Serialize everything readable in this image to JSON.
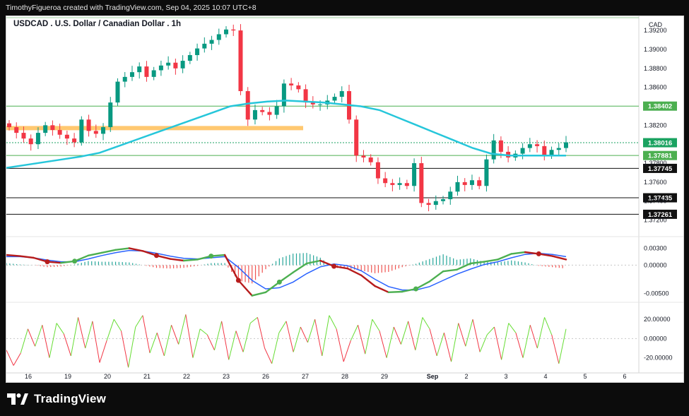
{
  "header": {
    "credit": "TimothyFigueroa created with TradingView.com, Sep 04, 2025 10:07 UTC+8"
  },
  "brand": {
    "name": "TradingView"
  },
  "chart_data": [
    {
      "type": "candlestick",
      "title": "USDCAD . U.S. Dollar / Canadian Dollar . 1h",
      "currency": "CAD",
      "ylim": [
        1.371,
        1.3932
      ],
      "y_ticks": [
        "1.39200",
        "1.39000",
        "1.38800",
        "1.38600",
        "1.38200",
        "1.37800",
        "1.37600",
        "1.37400",
        "1.37200"
      ],
      "x_labels": [
        "16",
        "19",
        "20",
        "21",
        "22",
        "23",
        "26",
        "27",
        "28",
        "29",
        "Sep",
        "2",
        "3",
        "4",
        "5",
        "6"
      ],
      "price_lines": [
        {
          "label": "1.38402",
          "value": 1.38402,
          "color": "#4caf50"
        },
        {
          "label": "1.38016",
          "value": 1.38016,
          "color": "#1aa260"
        },
        {
          "label": "1.37881",
          "value": 1.37881,
          "color": "#4caf50"
        },
        {
          "label": "1.37745",
          "value": 1.37745,
          "color": "#111111"
        },
        {
          "label": "1.37435",
          "value": 1.37435,
          "color": "#111111"
        },
        {
          "label": "1.37261",
          "value": 1.37261,
          "color": "#111111"
        }
      ],
      "zone": {
        "value": 1.3817,
        "color": "#ffc870"
      },
      "series": [
        {
          "name": "close",
          "values": [
            1.3818,
            1.3812,
            1.3806,
            1.38,
            1.3812,
            1.382,
            1.3815,
            1.381,
            1.3806,
            1.3802,
            1.3826,
            1.3814,
            1.3811,
            1.3818,
            1.3844,
            1.3866,
            1.3871,
            1.3876,
            1.3882,
            1.3871,
            1.3878,
            1.3883,
            1.3886,
            1.388,
            1.3888,
            1.3894,
            1.3901,
            1.3906,
            1.391,
            1.3916,
            1.3921,
            1.392,
            1.3856,
            1.3826,
            1.3836,
            1.3834,
            1.3831,
            1.384,
            1.3864,
            1.3862,
            1.3858,
            1.3844,
            1.3842,
            1.3842,
            1.3846,
            1.385,
            1.3856,
            1.3826,
            1.3788,
            1.3786,
            1.3781,
            1.3764,
            1.3759,
            1.3757,
            1.3759,
            1.3756,
            1.378,
            1.3738,
            1.3736,
            1.374,
            1.3742,
            1.375,
            1.376,
            1.3757,
            1.3762,
            1.3756,
            1.3784,
            1.3804,
            1.3792,
            1.3786,
            1.379,
            1.3796,
            1.38,
            1.3798,
            1.3788,
            1.3794,
            1.3796,
            1.3802
          ]
        },
        {
          "name": "sma",
          "values": [
            1.3775,
            1.3778,
            1.3781,
            1.3784,
            1.3787,
            1.3791,
            1.3798,
            1.3805,
            1.3812,
            1.3819,
            1.3826,
            1.3833,
            1.384,
            1.3843,
            1.3845,
            1.3846,
            1.3845,
            1.3844,
            1.3842,
            1.384,
            1.3836,
            1.3828,
            1.382,
            1.3812,
            1.3804,
            1.3796,
            1.379,
            1.3788,
            1.3788,
            1.3788,
            1.3788
          ]
        }
      ]
    },
    {
      "type": "line",
      "y_ticks": [
        "0.00300",
        "0.00000",
        "-0.00500"
      ],
      "ylim": [
        -0.0062,
        0.0038
      ],
      "series": [
        {
          "name": "macd",
          "values": [
            0.0018,
            0.0016,
            0.0013,
            0.0006,
            0.0004,
            0.0007,
            0.0017,
            0.0022,
            0.0027,
            0.003,
            0.0025,
            0.0017,
            0.0011,
            0.0008,
            0.001,
            0.0016,
            0.0018,
            -0.0027,
            -0.0054,
            -0.0048,
            -0.003,
            -0.0013,
            0.0003,
            0.0008,
            -0.0002,
            -0.0006,
            -0.0018,
            -0.0037,
            -0.0048,
            -0.0047,
            -0.0042,
            -0.0029,
            -0.0011,
            -0.0008,
            0.0003,
            0.0006,
            0.001,
            0.002,
            0.0023,
            0.002,
            0.0016,
            0.001
          ]
        },
        {
          "name": "signal",
          "values": [
            0.0015,
            0.0015,
            0.0013,
            0.0009,
            0.0006,
            0.0006,
            0.0011,
            0.0017,
            0.0022,
            0.0026,
            0.0025,
            0.0021,
            0.0016,
            0.0012,
            0.0011,
            0.0013,
            0.0015,
            -0.0004,
            -0.0027,
            -0.0042,
            -0.004,
            -0.003,
            -0.0015,
            -0.0003,
            0.0002,
            -0.0001,
            -0.001,
            -0.0025,
            -0.0038,
            -0.0044,
            -0.0044,
            -0.0038,
            -0.0027,
            -0.0016,
            -0.0007,
            0.0001,
            0.0006,
            0.0013,
            0.0019,
            0.0021,
            0.0019,
            0.0015
          ]
        }
      ]
    },
    {
      "type": "line",
      "y_ticks": [
        "20.00000",
        "0.00000",
        "-20.00000"
      ],
      "ylim": [
        -32,
        34
      ],
      "series": [
        {
          "name": "oscillator",
          "values": [
            -12,
            -28,
            -15,
            10,
            -8,
            14,
            -20,
            16,
            5,
            -18,
            22,
            -10,
            18,
            -25,
            -2,
            20,
            8,
            -30,
            12,
            24,
            -15,
            6,
            -18,
            14,
            -6,
            25,
            -20,
            10,
            4,
            -12,
            18,
            -22,
            8,
            -14,
            16,
            22,
            -10,
            -26,
            6,
            18,
            -14,
            12,
            -4,
            20,
            -18,
            24,
            10,
            -24,
            -2,
            14,
            -16,
            20,
            8,
            -20,
            12,
            -6,
            18,
            -12,
            22,
            10,
            -18,
            6,
            -24,
            16,
            -8,
            20,
            -14,
            4,
            12,
            -22,
            16,
            6,
            -20,
            14,
            -10,
            22,
            4,
            -26,
            10
          ]
        }
      ]
    }
  ]
}
